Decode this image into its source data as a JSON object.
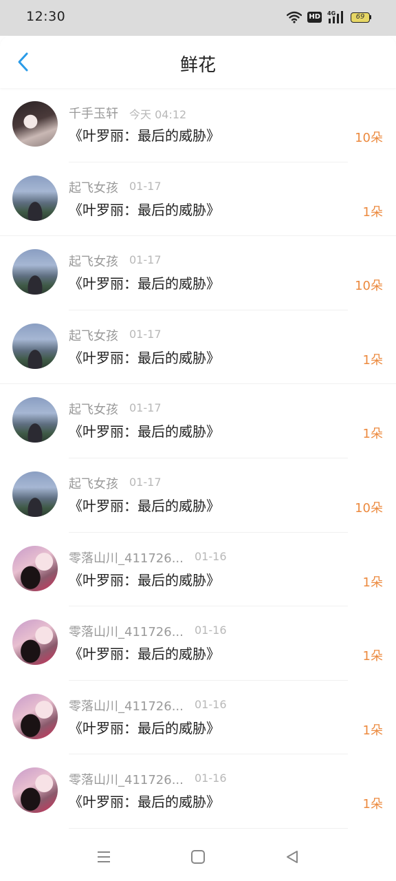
{
  "status_bar": {
    "time": "12:30",
    "network_badge": "HD",
    "signal_label": "4G",
    "battery_level": "69",
    "icons": [
      "wifi-icon",
      "hd-badge",
      "signal-icon",
      "battery-icon"
    ]
  },
  "header": {
    "title": "鲜花",
    "back_icon": "chevron-left-icon",
    "accent_color": "#2a9be8"
  },
  "colors": {
    "count": "#ec8a3f",
    "name": "#9a9a9a",
    "time": "#b8b8b8",
    "title": "#222222"
  },
  "list": {
    "items": [
      {
        "name": "千手玉轩",
        "time": "今天 04:12",
        "book": "《叶罗丽：最后的威胁》",
        "count": "10朵",
        "avatar": "avatar-girl-dark-hair"
      },
      {
        "name": "起飞女孩",
        "time": "01-17",
        "book": "《叶罗丽：最后的威胁》",
        "count": "1朵",
        "avatar": "avatar-landscape-girl"
      },
      {
        "name": "起飞女孩",
        "time": "01-17",
        "book": "《叶罗丽：最后的威胁》",
        "count": "10朵",
        "avatar": "avatar-landscape-girl"
      },
      {
        "name": "起飞女孩",
        "time": "01-17",
        "book": "《叶罗丽：最后的威胁》",
        "count": "1朵",
        "avatar": "avatar-landscape-girl"
      },
      {
        "name": "起飞女孩",
        "time": "01-17",
        "book": "《叶罗丽：最后的威胁》",
        "count": "1朵",
        "avatar": "avatar-landscape-girl"
      },
      {
        "name": "起飞女孩",
        "time": "01-17",
        "book": "《叶罗丽：最后的威胁》",
        "count": "10朵",
        "avatar": "avatar-landscape-girl"
      },
      {
        "name": "零落山川_411726...",
        "time": "01-16",
        "book": "《叶罗丽：最后的威胁》",
        "count": "1朵",
        "avatar": "avatar-pink-girl"
      },
      {
        "name": "零落山川_411726...",
        "time": "01-16",
        "book": "《叶罗丽：最后的威胁》",
        "count": "1朵",
        "avatar": "avatar-pink-girl"
      },
      {
        "name": "零落山川_411726...",
        "time": "01-16",
        "book": "《叶罗丽：最后的威胁》",
        "count": "1朵",
        "avatar": "avatar-pink-girl"
      },
      {
        "name": "零落山川_411726...",
        "time": "01-16",
        "book": "《叶罗丽：最后的威胁》",
        "count": "1朵",
        "avatar": "avatar-pink-girl"
      }
    ]
  },
  "system_nav": {
    "icons": [
      "menu-icon",
      "home-icon",
      "back-triangle-icon"
    ]
  }
}
